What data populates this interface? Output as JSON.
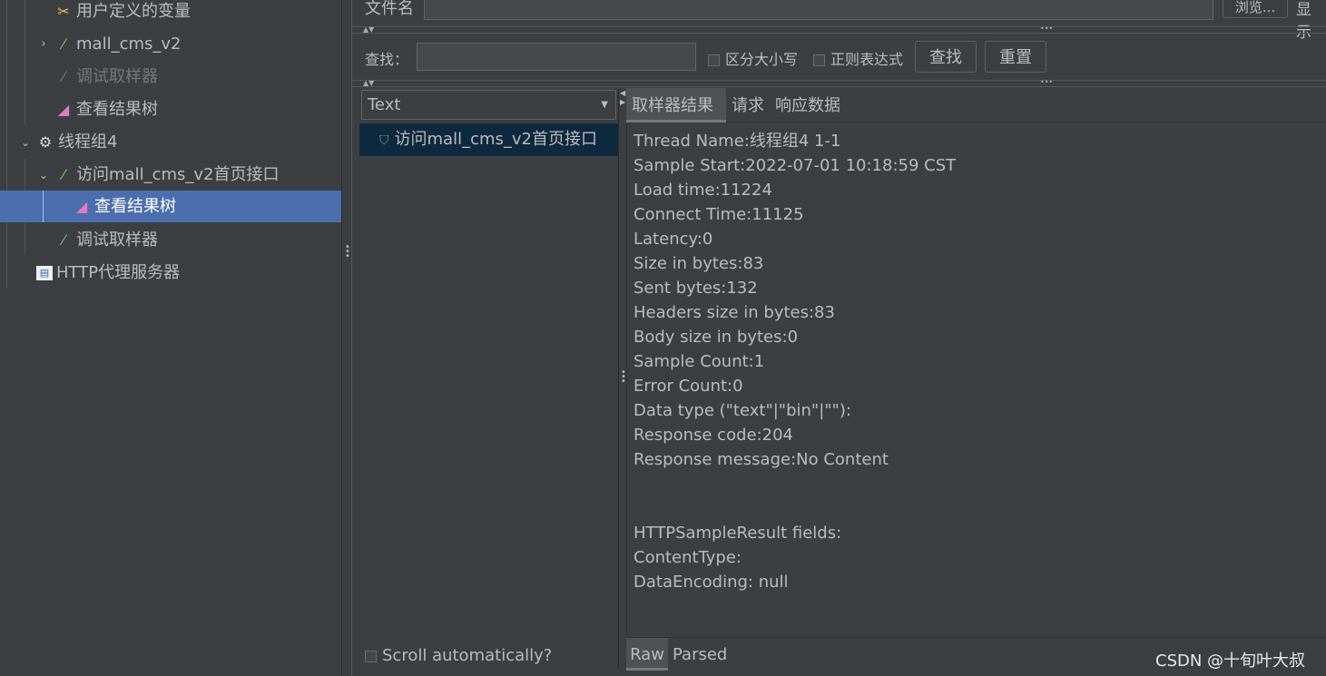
{
  "tree": {
    "items": [
      {
        "label": "用户定义的变量",
        "icon": "wrench-screwdriver-icon"
      },
      {
        "label": "mall_cms_v2",
        "icon": "pipette-icon",
        "expander": "collapsed"
      },
      {
        "label": "调试取样器",
        "icon": "pipette-icon",
        "disabled": true
      },
      {
        "label": "查看结果树",
        "icon": "results-tree-icon"
      },
      {
        "label": "线程组4",
        "icon": "gear-icon",
        "expander": "expanded"
      },
      {
        "label": "访问mall_cms_v2首页接口",
        "icon": "pipette-icon",
        "expander": "expanded"
      },
      {
        "label": "查看结果树",
        "icon": "results-tree-icon",
        "selected": true
      },
      {
        "label": "调试取样器",
        "icon": "pipette-icon"
      },
      {
        "label": "HTTP代理服务器",
        "icon": "proxy-server-icon"
      }
    ]
  },
  "file": {
    "label": "文件名",
    "value": "",
    "browse": "浏览...",
    "display": "显示"
  },
  "search": {
    "label": "查找：",
    "value": "",
    "case_sensitive": "区分大小写",
    "regex": "正则表达式",
    "find": "查找",
    "reset": "重置"
  },
  "renderer": {
    "selected": "Text"
  },
  "results": [
    {
      "label": "访问mall_cms_v2首页接口",
      "status": "success"
    }
  ],
  "tabs": [
    {
      "label": "取样器结果",
      "active": true
    },
    {
      "label": "请求"
    },
    {
      "label": "响应数据"
    }
  ],
  "detail_lines": [
    "Thread Name:线程组4 1-1",
    "Sample Start:2022-07-01 10:18:59 CST",
    "Load time:11224",
    "Connect Time:11125",
    "Latency:0",
    "Size in bytes:83",
    "Sent bytes:132",
    "Headers size in bytes:83",
    "Body size in bytes:0",
    "Sample Count:1",
    "Error Count:0",
    "Data type (\"text\"|\"bin\"|\"\"):",
    "Response code:204",
    "Response message:No Content",
    "",
    "",
    "HTTPSampleResult fields:",
    "ContentType:",
    "DataEncoding: null"
  ],
  "scroll_auto": "Scroll automatically?",
  "bottom_tabs": [
    {
      "label": "Raw",
      "active": true
    },
    {
      "label": "Parsed"
    }
  ],
  "watermark": "CSDN @十旬叶大叔"
}
